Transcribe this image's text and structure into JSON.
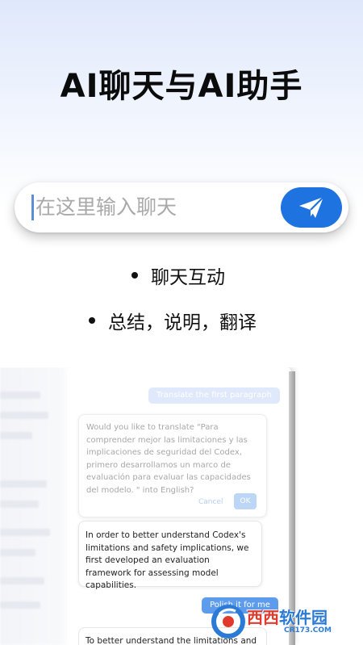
{
  "hero": {
    "title": "AI聊天与AI助手"
  },
  "chat_input": {
    "placeholder": "在这里输入聊天",
    "send_icon": "paper-plane-send-icon",
    "accent_color": "#1f73e0"
  },
  "features": [
    {
      "label": "聊天互动"
    },
    {
      "label": "总结，说明，翻译"
    }
  ],
  "preview": {
    "user_message_1": "Translate the first paragraph",
    "dialog": {
      "text": "Would you like to translate \"Para comprender mejor las limitaciones y las implicaciones de seguridad del Codex, primero desarrollamos un marco de evaluación para evaluar las capacidades del modelo. \" into English?",
      "cancel_label": "Cancel",
      "ok_label": "OK"
    },
    "ai_message_1": "In order to better understand Codex's limitations and safety implications, we first developed an evaluation framework for assessing model capabilities.",
    "user_message_2": "Polish it for me",
    "ai_message_2": "To better understand the limitations and"
  },
  "watermark": {
    "main_a": "西西",
    "main_b": "软件园",
    "sub": "CR173.COM"
  }
}
